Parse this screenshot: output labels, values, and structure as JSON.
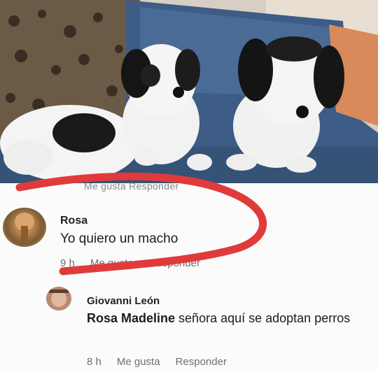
{
  "post": {
    "cutoff_actions": "Me gusta  Responder"
  },
  "comments": [
    {
      "author": "Rosa",
      "text": "Yo quiero un macho",
      "time": "9 h",
      "like_label": "Me gusta",
      "reply_label": "Responder"
    }
  ],
  "reply": {
    "author": "Giovanni León",
    "mention": "Rosa Madeline",
    "text": " señora aquí se adoptan perros",
    "time": "8 h",
    "like_label": "Me gusta",
    "reply_label": "Responder"
  },
  "colors": {
    "scribble": "#e03a3a",
    "couch": "#3d5c86",
    "action_text": "#6f6f6f"
  },
  "icons": {
    "rosa_avatar": "avatar-photo",
    "giovanni_avatar": "avatar-photo"
  }
}
